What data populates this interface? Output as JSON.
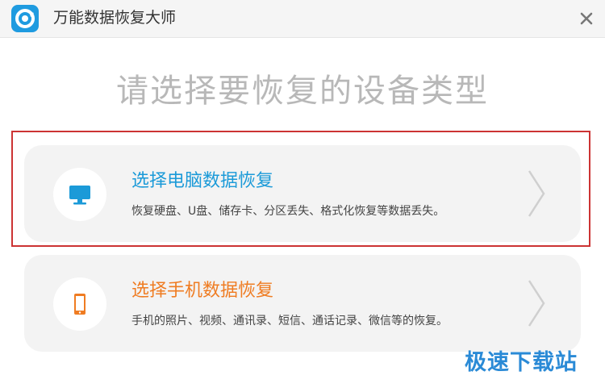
{
  "window": {
    "title": "万能数据恢复大师",
    "logo_icon": "recovery-logo-icon",
    "close_icon": "close-icon"
  },
  "headline": "请选择要恢复的设备类型",
  "options": [
    {
      "title": "选择电脑数据恢复",
      "description": "恢复硬盘、U盘、储存卡、分区丢失、格式化恢复等数据丢失。",
      "icon": "monitor-icon",
      "accent": "#1b9ad8",
      "highlighted": true
    },
    {
      "title": "选择手机数据恢复",
      "description": "手机的照片、视频、通讯录、短信、通话记录、微信等的恢复。",
      "icon": "smartphone-icon",
      "accent": "#ef7c22",
      "highlighted": false
    }
  ],
  "watermark": "极速下载站",
  "colors": {
    "highlight_border": "#cc3333",
    "headline": "#b8b8b8",
    "watermark": "#2a8ad6"
  }
}
